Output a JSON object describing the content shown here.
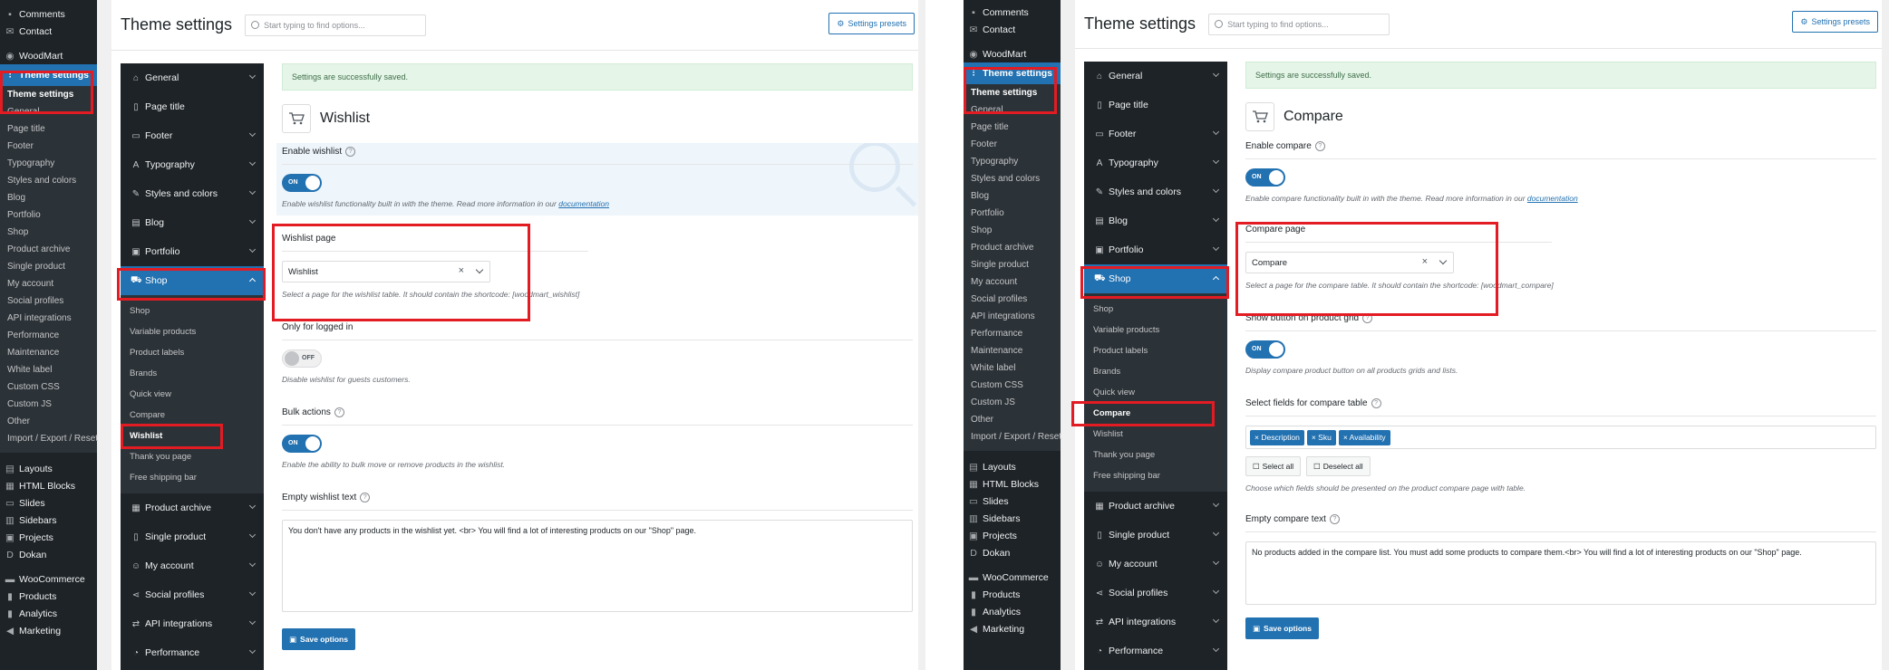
{
  "panels": {
    "wishlist": {
      "wp_menu": {
        "top": [
          {
            "icon": "speech-bubble-icon",
            "label": "Comments"
          },
          {
            "icon": "mail-icon",
            "label": "Contact"
          }
        ],
        "woodmart": "WoodMart",
        "theme_settings": "Theme settings",
        "submenu": [
          "Theme settings",
          "General",
          "Page title",
          "Footer",
          "Typography",
          "Styles and colors",
          "Blog",
          "Portfolio",
          "Shop",
          "Product archive",
          "Single product",
          "My account",
          "Social profiles",
          "API integrations",
          "Performance",
          "Maintenance",
          "White label",
          "Custom CSS",
          "Custom JS",
          "Other",
          "Import / Export / Reset"
        ],
        "bottom": [
          "Layouts",
          "HTML Blocks",
          "Slides",
          "Sidebars",
          "Projects",
          "Dokan"
        ],
        "bottom2": [
          "WooCommerce",
          "Products",
          "Analytics",
          "Marketing"
        ]
      },
      "header": {
        "title": "Theme settings",
        "search_placeholder": "Start typing to find options...",
        "presets": "Settings presets"
      },
      "nav": {
        "before": [
          "General",
          "Page title",
          "Footer",
          "Typography",
          "Styles and colors",
          "Blog",
          "Portfolio"
        ],
        "open": "Shop",
        "sub": [
          "Shop",
          "Variable products",
          "Product labels",
          "Brands",
          "Quick view",
          "Compare",
          "Wishlist",
          "Thank you page",
          "Free shipping bar"
        ],
        "after": [
          "Product archive",
          "Single product",
          "My account",
          "Social profiles",
          "API integrations",
          "Performance"
        ]
      },
      "notice": "Settings are successfully saved.",
      "section_title": "Wishlist",
      "enable": {
        "label": "Enable wishlist",
        "state": "ON",
        "desc": "Enable wishlist functionality built in with the theme. Read more information in our",
        "link": "documentation"
      },
      "page": {
        "label": "Wishlist page",
        "value": "Wishlist",
        "desc": "Select a page for the wishlist table. It should contain the shortcode: [woodmart_wishlist]"
      },
      "logged": {
        "label": "Only for logged in",
        "state": "OFF",
        "desc": "Disable wishlist for guests customers."
      },
      "bulk": {
        "label": "Bulk actions",
        "state": "ON",
        "desc": "Enable the ability to bulk move or remove products in the wishlist."
      },
      "empty": {
        "label": "Empty wishlist text",
        "value": "You don't have any products in the wishlist yet. <br> You will find a lot of interesting products on our \"Shop\" page."
      },
      "save": "Save options"
    },
    "compare": {
      "wp_menu": {
        "top": [
          {
            "icon": "speech-bubble-icon",
            "label": "Comments"
          },
          {
            "icon": "mail-icon",
            "label": "Contact"
          }
        ],
        "woodmart": "WoodMart",
        "theme_settings": "Theme settings",
        "submenu": [
          "Theme settings",
          "General",
          "Page title",
          "Footer",
          "Typography",
          "Styles and colors",
          "Blog",
          "Portfolio",
          "Shop",
          "Product archive",
          "Single product",
          "My account",
          "Social profiles",
          "API integrations",
          "Performance",
          "Maintenance",
          "White label",
          "Custom CSS",
          "Custom JS",
          "Other",
          "Import / Export / Reset"
        ],
        "bottom": [
          "Layouts",
          "HTML Blocks",
          "Slides",
          "Sidebars",
          "Projects",
          "Dokan"
        ],
        "bottom2": [
          "WooCommerce",
          "Products",
          "Analytics",
          "Marketing"
        ]
      },
      "header": {
        "title": "Theme settings",
        "search_placeholder": "Start typing to find options...",
        "presets": "Settings presets"
      },
      "nav": {
        "before": [
          "General",
          "Page title",
          "Footer",
          "Typography",
          "Styles and colors",
          "Blog",
          "Portfolio"
        ],
        "open": "Shop",
        "sub": [
          "Shop",
          "Variable products",
          "Product labels",
          "Brands",
          "Quick view",
          "Compare",
          "Wishlist",
          "Thank you page",
          "Free shipping bar"
        ],
        "after": [
          "Product archive",
          "Single product",
          "My account",
          "Social profiles",
          "API integrations",
          "Performance"
        ]
      },
      "notice": "Settings are successfully saved.",
      "section_title": "Compare",
      "enable": {
        "label": "Enable compare",
        "state": "ON",
        "desc": "Enable compare functionality built in with the theme. Read more information in our",
        "link": "documentation"
      },
      "page": {
        "label": "Compare page",
        "value": "Compare",
        "desc": "Select a page for the compare table. It should contain the shortcode: [woodmart_compare]"
      },
      "show_btn": {
        "label": "Show button on product grid",
        "state": "ON",
        "desc": "Display compare product button on all products grids and lists."
      },
      "fields": {
        "label": "Select fields for compare table",
        "tags": [
          "× Description",
          "× Sku",
          "× Availability"
        ],
        "select_all": "Select all",
        "deselect_all": "Deselect all",
        "desc": "Choose which fields should be presented on the product compare page with table."
      },
      "empty": {
        "label": "Empty compare text",
        "value": "No products added in the compare list. You must add some products to compare them.<br> You will find a lot of interesting products on our \"Shop\" page."
      },
      "save": "Save options"
    }
  },
  "colors": {
    "accent": "#2271b1",
    "highlight": "#e31b23",
    "sidebar": "#1d2327",
    "notice_bg": "#e5f5e8"
  }
}
